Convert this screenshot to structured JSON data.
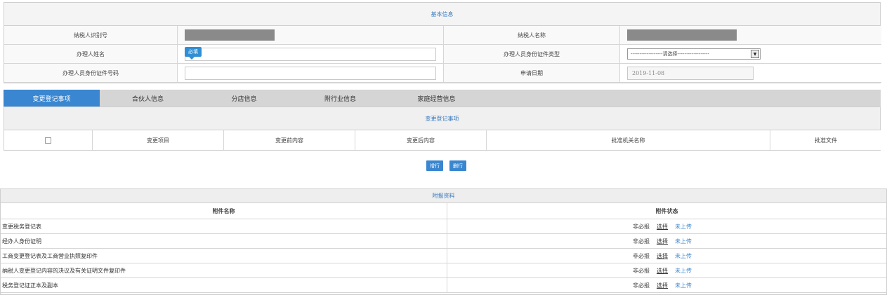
{
  "basic_info": {
    "title": "基本信息",
    "taxpayer_id_label": "纳税人识别号",
    "taxpayer_name_label": "纳税人名称",
    "handler_name_label": "办理人姓名",
    "handler_name_tip": "必填",
    "handler_id_type_label": "办理人员身份证件类型",
    "handler_id_type_value": "------------------请选择------------------",
    "handler_id_no_label": "办理人员身份证件号码",
    "apply_date_label": "申请日期",
    "apply_date_value": "2019-11-08"
  },
  "tabs": [
    {
      "label": "变更登记事项",
      "active": true
    },
    {
      "label": "合伙人信息",
      "active": false
    },
    {
      "label": "分店信息",
      "active": false
    },
    {
      "label": "附行业信息",
      "active": false
    },
    {
      "label": "家庭经营信息",
      "active": false
    }
  ],
  "change_items": {
    "title": "变更登记事项",
    "columns": [
      "变更项目",
      "变更前内容",
      "变更后内容",
      "批准机关名称",
      "批准文件"
    ],
    "add_row_label": "增行",
    "delete_row_label": "删行"
  },
  "attachments": {
    "title": "附报资料",
    "col_name": "附件名称",
    "col_status": "附件状态",
    "rows": [
      {
        "name": "变更税务登记表",
        "optional": "非必报",
        "choose": "选择",
        "status": "未上传"
      },
      {
        "name": "经办人身份证明",
        "optional": "非必报",
        "choose": "选择",
        "status": "未上传"
      },
      {
        "name": "工商变更登记表及工商营业执照复印件",
        "optional": "非必报",
        "choose": "选择",
        "status": "未上传"
      },
      {
        "name": "纳税人变更登记内容的决议及有关证明文件复印件",
        "optional": "非必报",
        "choose": "选择",
        "status": "未上传"
      },
      {
        "name": "税务登记证正本及副本",
        "optional": "非必报",
        "choose": "选择",
        "status": "未上传"
      }
    ]
  },
  "colors": {
    "accent": "#3a86d0",
    "title_text": "#3a7bbf",
    "masked": "#8a8a8a"
  }
}
